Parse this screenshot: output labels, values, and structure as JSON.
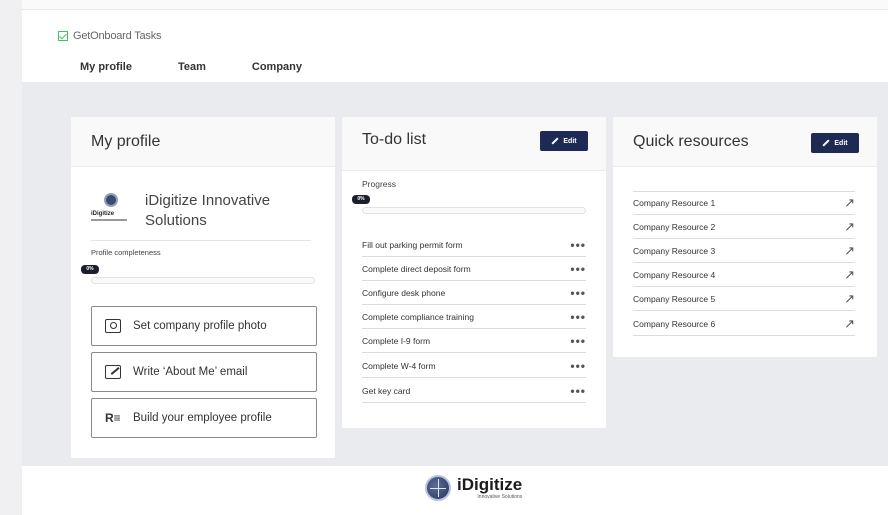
{
  "app": {
    "title": "GetOnboard Tasks"
  },
  "tabs": [
    {
      "label": "My profile",
      "active": true
    },
    {
      "label": "Team",
      "active": false
    },
    {
      "label": "Company",
      "active": false
    }
  ],
  "profile": {
    "title": "My profile",
    "org_name": "iDigitize Innovative Solutions",
    "logo_text": "iDigitize",
    "completeness_label": "Profile completeness",
    "completeness_pct": "0%",
    "actions": [
      {
        "label": "Set company profile photo",
        "icon": "camera-icon"
      },
      {
        "label": "Write ‘About Me’ email",
        "icon": "email-edit-icon"
      },
      {
        "label": "Build your employee profile",
        "icon": "person-list-icon"
      }
    ]
  },
  "todo": {
    "title": "To-do list",
    "edit_label": "Edit",
    "progress_label": "Progress",
    "progress_pct": "0%",
    "items": [
      {
        "label": "Fill out parking permit form"
      },
      {
        "label": "Complete direct deposit form"
      },
      {
        "label": "Configure desk phone"
      },
      {
        "label": "Complete compliance training"
      },
      {
        "label": "Complete I-9 form"
      },
      {
        "label": "Complete W-4 form"
      },
      {
        "label": "Get key card"
      }
    ]
  },
  "resources": {
    "title": "Quick resources",
    "edit_label": "Edit",
    "items": [
      {
        "label": "Company Resource 1"
      },
      {
        "label": "Company Resource 2"
      },
      {
        "label": "Company Resource 3"
      },
      {
        "label": "Company Resource 4"
      },
      {
        "label": "Company Resource 5"
      },
      {
        "label": "Company Resource 6"
      }
    ]
  },
  "footer": {
    "brand": "iDigitize",
    "tagline": "Innovative Solutions"
  },
  "colors": {
    "accent": "#2dc254",
    "button": "#1e2a54",
    "canvas": "#e9ebef"
  }
}
